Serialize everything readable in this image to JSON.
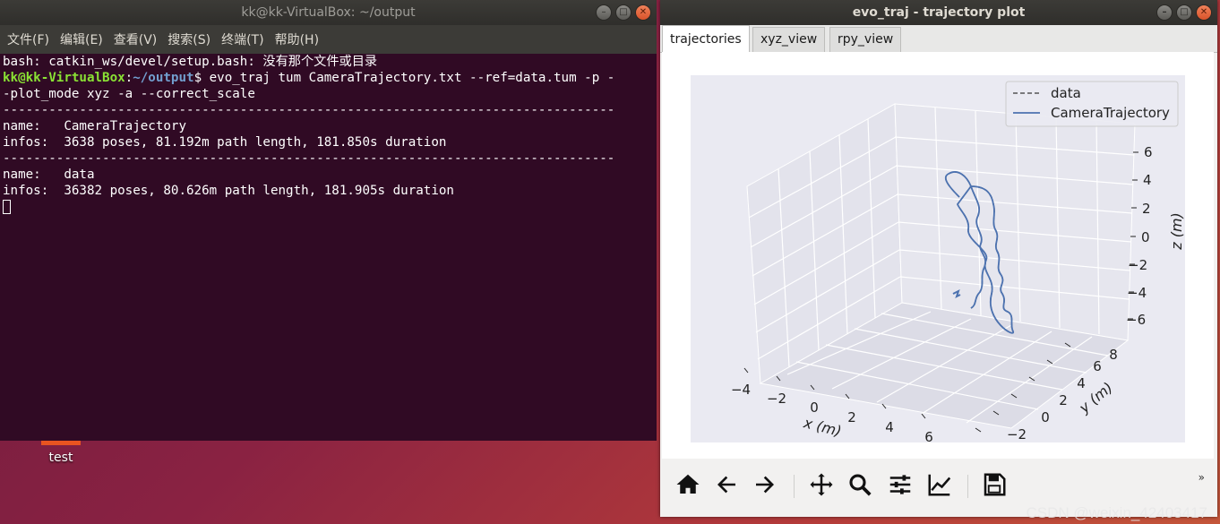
{
  "terminal": {
    "title": "kk@kk-VirtualBox: ~/output",
    "menu": [
      "文件(F)",
      "编辑(E)",
      "查看(V)",
      "搜索(S)",
      "终端(T)",
      "帮助(H)"
    ],
    "lines": {
      "l1": "bash: catkin_ws/devel/setup.bash: 没有那个文件或目录",
      "prompt_user": "kk@kk-VirtualBox",
      "prompt_colon": ":",
      "prompt_path": "~/output",
      "prompt_cmd": "$ evo_traj tum CameraTrajectory.txt --ref=data.tum -p -",
      "l3": "-plot_mode xyz -a --correct_scale",
      "sep": "--------------------------------------------------------------------------------",
      "name1": "name:   CameraTrajectory",
      "infos1": "infos:  3638 poses, 81.192m path length, 181.850s duration",
      "name2": "name:   data",
      "infos2": "infos:  36382 poses, 80.626m path length, 181.905s duration"
    }
  },
  "desktop": {
    "icon_label": "test"
  },
  "plot_window": {
    "title": "evo_traj - trajectory plot",
    "tabs": [
      "trajectories",
      "xyz_view",
      "rpy_view"
    ],
    "active_tab": "trajectories"
  },
  "chart_data": {
    "type": "line",
    "projection": "3d",
    "xlabel": "x (m)",
    "ylabel": "y (m)",
    "zlabel": "z (m)",
    "x_ticks": [
      "−4",
      "−2",
      "0",
      "2",
      "4",
      "6"
    ],
    "y_ticks": [
      "−2",
      "0",
      "2",
      "4",
      "6",
      "8"
    ],
    "z_ticks": [
      "6",
      "4",
      "2",
      "0",
      "−2",
      "−4",
      "−6"
    ],
    "legend": [
      "data",
      "CameraTrajectory"
    ],
    "legend_position": "top-right",
    "grid": true,
    "colors": {
      "data": "#555555",
      "CameraTrajectory": "#4c72b0",
      "pane": "#eaeaf2"
    }
  },
  "watermark": "CSDN @weixin_42403417"
}
